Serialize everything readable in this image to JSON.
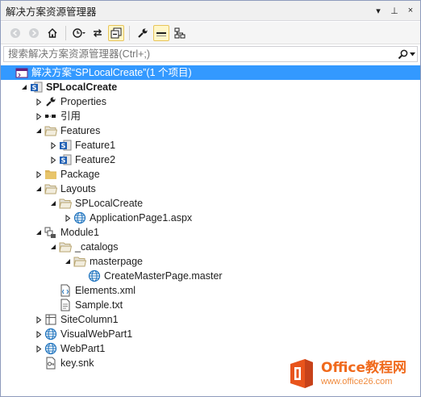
{
  "window": {
    "title": "解决方案资源管理器"
  },
  "titlebar_buttons": {
    "dropdown": "▾",
    "pin": "⊥",
    "close": "×"
  },
  "search": {
    "placeholder": "搜索解决方案资源管理器(Ctrl+;)",
    "value": ""
  },
  "tree": [
    {
      "label": "解决方案“SPLocalCreate”(1 个项目)",
      "icon": "solution-icon",
      "level": 0,
      "arrow": "none",
      "selected": true,
      "bold": false
    },
    {
      "label": "SPLocalCreate",
      "icon": "sharepoint-project-icon",
      "level": 1,
      "arrow": "expanded",
      "selected": false,
      "bold": true
    },
    {
      "label": "Properties",
      "icon": "wrench-icon",
      "level": 2,
      "arrow": "collapsed",
      "selected": false,
      "bold": false
    },
    {
      "label": "引用",
      "icon": "references-icon",
      "level": 2,
      "arrow": "collapsed",
      "selected": false,
      "bold": false
    },
    {
      "label": "Features",
      "icon": "folder-open-icon",
      "level": 2,
      "arrow": "expanded",
      "selected": false,
      "bold": false
    },
    {
      "label": "Feature1",
      "icon": "feature-icon",
      "level": 3,
      "arrow": "collapsed",
      "selected": false,
      "bold": false
    },
    {
      "label": "Feature2",
      "icon": "feature-icon",
      "level": 3,
      "arrow": "collapsed",
      "selected": false,
      "bold": false
    },
    {
      "label": "Package",
      "icon": "folder-icon",
      "level": 2,
      "arrow": "collapsed",
      "selected": false,
      "bold": false
    },
    {
      "label": "Layouts",
      "icon": "folder-open-icon",
      "level": 2,
      "arrow": "expanded",
      "selected": false,
      "bold": false
    },
    {
      "label": "SPLocalCreate",
      "icon": "folder-open-icon",
      "level": 3,
      "arrow": "expanded",
      "selected": false,
      "bold": false
    },
    {
      "label": "ApplicationPage1.aspx",
      "icon": "web-page-icon",
      "level": 4,
      "arrow": "collapsed",
      "selected": false,
      "bold": false
    },
    {
      "label": "Module1",
      "icon": "module-icon",
      "level": 2,
      "arrow": "expanded",
      "selected": false,
      "bold": false
    },
    {
      "label": "_catalogs",
      "icon": "folder-open-icon",
      "level": 3,
      "arrow": "expanded",
      "selected": false,
      "bold": false
    },
    {
      "label": "masterpage",
      "icon": "folder-open-icon",
      "level": 4,
      "arrow": "expanded",
      "selected": false,
      "bold": false
    },
    {
      "label": "CreateMasterPage.master",
      "icon": "globe-icon",
      "level": 5,
      "arrow": "none",
      "selected": false,
      "bold": false
    },
    {
      "label": "Elements.xml",
      "icon": "xml-file-icon",
      "level": 3,
      "arrow": "none",
      "selected": false,
      "bold": false
    },
    {
      "label": "Sample.txt",
      "icon": "text-file-icon",
      "level": 3,
      "arrow": "none",
      "selected": false,
      "bold": false
    },
    {
      "label": "SiteColumn1",
      "icon": "site-column-icon",
      "level": 2,
      "arrow": "collapsed",
      "selected": false,
      "bold": false
    },
    {
      "label": "VisualWebPart1",
      "icon": "globe-icon",
      "level": 2,
      "arrow": "collapsed",
      "selected": false,
      "bold": false
    },
    {
      "label": "WebPart1",
      "icon": "globe-icon",
      "level": 2,
      "arrow": "collapsed",
      "selected": false,
      "bold": false
    },
    {
      "label": "key.snk",
      "icon": "key-file-icon",
      "level": 2,
      "arrow": "none",
      "selected": false,
      "bold": false
    }
  ],
  "watermark": {
    "title": "Office教程网",
    "url": "www.office26.com"
  },
  "colors": {
    "selection": "#3399ff",
    "accent_orange": "#f06a1c",
    "folder": "#dcb45a"
  }
}
